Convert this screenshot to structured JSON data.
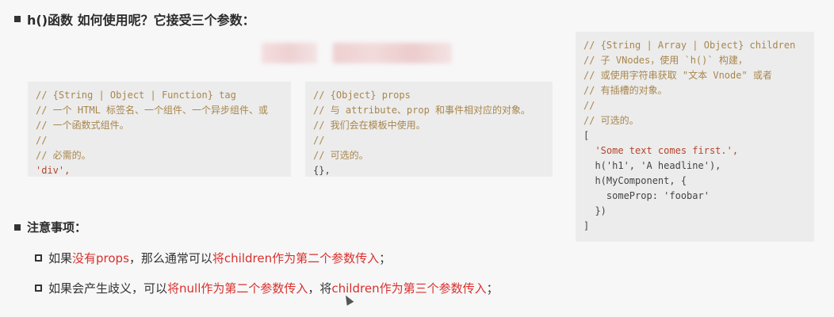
{
  "heading": "h()函数 如何使用呢？它接受三个参数：",
  "box_tag": [
    {
      "text": "// {String | Object | Function} tag",
      "kind": "comment"
    },
    {
      "text": "// 一个 HTML 标签名、一个组件、一个异步组件、或",
      "kind": "comment"
    },
    {
      "text": "// 一个函数式组件。",
      "kind": "comment"
    },
    {
      "text": "//",
      "kind": "comment"
    },
    {
      "text": "// 必需的。",
      "kind": "comment"
    },
    {
      "text": "'div',",
      "kind": "string"
    }
  ],
  "box_props": [
    {
      "text": "// {Object} props",
      "kind": "comment"
    },
    {
      "text": "// 与 attribute、prop 和事件相对应的对象。",
      "kind": "comment"
    },
    {
      "text": "// 我们会在模板中使用。",
      "kind": "comment"
    },
    {
      "text": "//",
      "kind": "comment"
    },
    {
      "text": "// 可选的。",
      "kind": "comment"
    },
    {
      "text": "{},",
      "kind": "plain"
    }
  ],
  "box_children": [
    {
      "text": "// {String | Array | Object} children",
      "kind": "comment"
    },
    {
      "text": "// 子 VNodes，使用 `h()` 构建，",
      "kind": "comment"
    },
    {
      "text": "// 或使用字符串获取 \"文本 Vnode\" 或者",
      "kind": "comment"
    },
    {
      "text": "// 有插槽的对象。",
      "kind": "comment"
    },
    {
      "text": "//",
      "kind": "comment"
    },
    {
      "text": "// 可选的。",
      "kind": "comment"
    },
    {
      "text": "[",
      "kind": "plain"
    },
    {
      "text": "  'Some text comes first.',",
      "kind": "string"
    },
    {
      "text": "  h('h1', 'A headline'),",
      "kind": "plain"
    },
    {
      "text": "  h(MyComponent, {",
      "kind": "plain"
    },
    {
      "text": "    someProp: 'foobar'",
      "kind": "plain"
    },
    {
      "text": "  })",
      "kind": "plain"
    },
    {
      "text": "]",
      "kind": "plain"
    }
  ],
  "notes_title": "注意事项：",
  "note_1": {
    "a": "如果",
    "b": "没有props",
    "c": "，那么通常可以",
    "d": "将children作为第二个参数传入",
    "e": "；"
  },
  "note_2": {
    "a": "如果会产生歧义，可以",
    "b": "将null作为第二个参数传入",
    "c": "，将",
    "d": "children作为第三个参数传入",
    "e": "；"
  }
}
